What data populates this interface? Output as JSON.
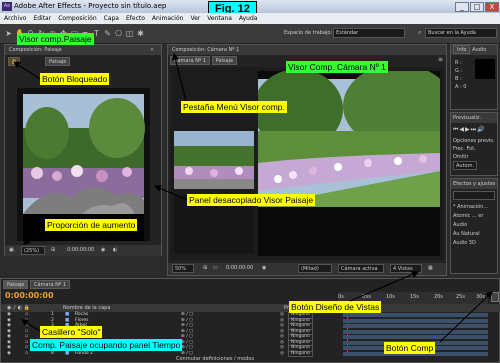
{
  "figure_label": "Fig. 12",
  "window": {
    "title": "Adobe After Effects - Proyecto sin título.aep",
    "controls": [
      "_",
      "□",
      "X"
    ]
  },
  "menu": [
    "Archivo",
    "Editar",
    "Composición",
    "Capa",
    "Efecto",
    "Animación",
    "Ver",
    "Ventana",
    "Ayuda"
  ],
  "toolbar": {
    "workspace_label": "Espacio de trabajo:",
    "workspace_value": "Estándar",
    "help_placeholder": "Buscar en la Ayuda"
  },
  "left_viewer": {
    "header": "Composición: Paisaje",
    "tab": "Paisaje",
    "zoom": "(25%)",
    "timecode": "0:00:00:00"
  },
  "main_viewer": {
    "header": "Composición: Cámara Nº 1",
    "tabs": [
      "Cámara Nº 1",
      "Paisaje"
    ],
    "zoom": "50%",
    "timecode": "0:00:00:00",
    "resolution": "(Mitad)",
    "view": "Cámara activa",
    "layout": "4 Vistas"
  },
  "right_panels": {
    "info_tab": "Info",
    "audio_tab": "Audio",
    "info_rows": [
      "R :",
      "G :",
      "B :",
      "A : 0"
    ],
    "preview_tab": "Previsualiz.",
    "preview_options": [
      "Opciones previs.",
      "Frec. Fot.",
      "Omitir",
      "Autom."
    ],
    "effects_tab": "Efectos y ajustes",
    "effects_items": [
      "* Animación...",
      "Atomic ... er",
      "Audio",
      "Au Natural",
      "Audio 3D"
    ]
  },
  "timeline": {
    "tabs": [
      "Paisaje",
      "Cámara Nº 1"
    ],
    "timecode": "0:00:00:00",
    "column_header": "Nombre de la capa",
    "parent_header": "Primario",
    "layers": [
      {
        "num": "1",
        "name": "Rocas",
        "parent": "Ninguno"
      },
      {
        "num": "2",
        "name": "Flores",
        "parent": "Ninguno"
      },
      {
        "num": "3",
        "name": "Árbol",
        "parent": "Ninguno"
      },
      {
        "num": "4",
        "name": "Pasto",
        "parent": "Ninguno"
      },
      {
        "num": "5",
        "name": "Fondo 1",
        "parent": "Ninguno"
      },
      {
        "num": "6",
        "name": "Nube",
        "parent": "Ninguno"
      },
      {
        "num": "7",
        "name": "Fondo 3",
        "parent": "Ninguno"
      },
      {
        "num": "8",
        "name": "Fondo 2",
        "parent": "Ninguno"
      }
    ],
    "ruler": [
      "0s",
      "05s",
      "10s",
      "15s",
      "20s",
      "25s",
      "30s"
    ],
    "footer": "Conmutar definiciones / modos"
  },
  "callouts": {
    "visor_paisaje": "Visor comp.Paisaje",
    "boton_bloqueado": "Botón Bloqueado",
    "visor_camara": "Visor Comp. Cámara Nº 1",
    "pestana_menu": "Pestaña Menú Visor comp.",
    "panel_desacoplado": "Panel desacoplado Visor Paisaje",
    "proporcion": "Proporción de aumento",
    "boton_diseno": "Botón Diseño de Vistas",
    "casillero_solo": "Casillero \"Solo\"",
    "comp_paisaje": "Comp. Paisaje ocupando panel Tiempo",
    "boton_comp": "Botón Comp"
  },
  "colors": {
    "callout_yellow": "#ffff00",
    "callout_cyan": "#00ffff",
    "callout_green": "#33ff33",
    "timecode": "#e8a030",
    "panel_dark": "#232323"
  }
}
